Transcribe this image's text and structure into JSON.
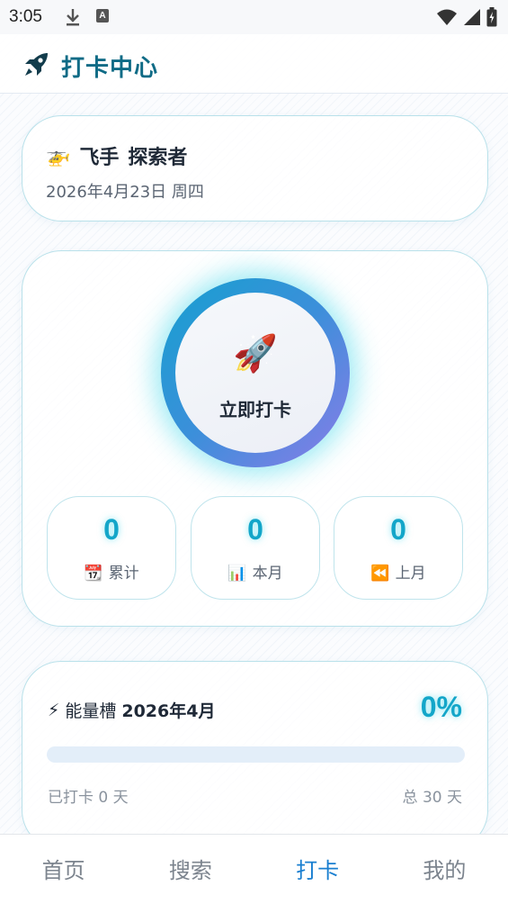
{
  "status_bar": {
    "time": "3:05",
    "download_icon": "download-icon",
    "a_icon_letter": "A",
    "wifi_icon": "wifi-icon",
    "signal_icon": "signal-icon",
    "battery_icon": "battery-icon"
  },
  "header": {
    "title": "打卡中心",
    "icon": "rocket-icon"
  },
  "user": {
    "emoji": "🚁",
    "name": "飞手",
    "title": "探索者",
    "date": "2026年4月23日 周四"
  },
  "checkin": {
    "emoji": "🚀",
    "button_label": "立即打卡"
  },
  "stats": [
    {
      "value": "0",
      "emoji": "📆",
      "label": "累计"
    },
    {
      "value": "0",
      "emoji": "📊",
      "label": "本月"
    },
    {
      "value": "0",
      "emoji": "⏪",
      "label": "上月"
    }
  ],
  "energy": {
    "emoji": "⚡",
    "label": "能量槽",
    "month": "2026年4月",
    "percent_text": "0%",
    "progress_fraction": 0,
    "checked_text": "已打卡 0 天",
    "total_text": "总 30 天"
  },
  "nav": {
    "items": [
      "首页",
      "搜索",
      "打卡",
      "我的"
    ],
    "active_index": 2
  },
  "colors": {
    "accent": "#13a6c9",
    "title": "#0f6b86",
    "nav_active": "#1a7fd0"
  }
}
